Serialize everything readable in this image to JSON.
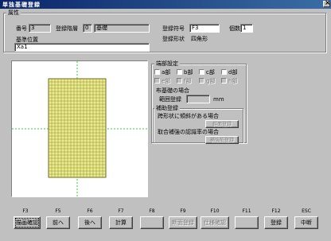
{
  "window": {
    "title": "単独基礎登録"
  },
  "attributes": {
    "group_label": "属性",
    "number_label": "番号",
    "number_value": "3",
    "floor_label": "登録階層",
    "floor_value": "0",
    "floor_name": "基礎",
    "code_label": "登録符号",
    "code_value": "F3",
    "count_label": "個数",
    "count_value": "1",
    "shape_label": "登録形状",
    "shape_value": "四角形",
    "base_pos_label": "基準位置",
    "base_pos_value": "Xa1"
  },
  "ending": {
    "group_label": "端部設定",
    "parts": [
      {
        "label": "a部",
        "enabled": true
      },
      {
        "label": "b部",
        "enabled": true
      },
      {
        "label": "c部",
        "enabled": true
      },
      {
        "label": "d部",
        "enabled": true
      }
    ],
    "parts_disabled": [
      {
        "label": "e部"
      },
      {
        "label": "f部"
      },
      {
        "label": "g部"
      },
      {
        "label": "h部"
      }
    ],
    "cloth_base_label": "布基礎の場合",
    "range_label": "範囲登録",
    "range_value": "",
    "range_unit": "mm"
  },
  "aux": {
    "group_label": "補助登録",
    "slope_case": "跨形状に傾斜がある場合",
    "slope_button": "斜面登録",
    "rebar_case": "取合補強の認識率の場合",
    "rebar_button": "補強筋登録"
  },
  "function_keys": [
    "F3",
    "F5",
    "F6",
    "F7",
    "F8",
    "F9",
    "F10",
    "F11",
    "F12",
    "ESC"
  ],
  "buttons": [
    {
      "label": "描画確認",
      "enabled": true,
      "focus": true
    },
    {
      "label": "前へ",
      "enabled": true
    },
    {
      "label": "後へ",
      "enabled": true
    },
    {
      "label": "計算",
      "enabled": true
    },
    {
      "label": "",
      "enabled": false
    },
    {
      "label": "断面登録",
      "enabled": false
    },
    {
      "label": "仕様確認",
      "enabled": false
    },
    {
      "label": "",
      "enabled": false
    },
    {
      "label": "登録",
      "enabled": true
    },
    {
      "label": "中断",
      "enabled": true
    }
  ],
  "colors": {
    "footing_fill": "#ecec8c",
    "footing_grid": "#8a8a3a",
    "guide": "#3bd13b"
  }
}
